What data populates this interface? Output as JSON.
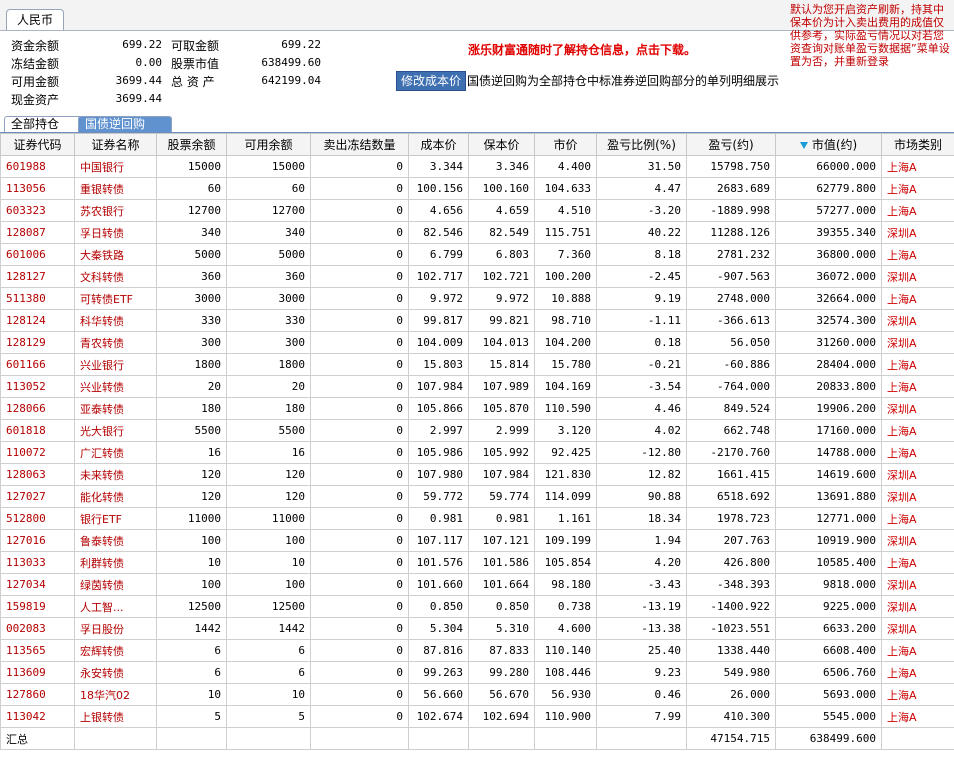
{
  "currency_tab": "人民币",
  "summary": {
    "cash_balance_label": "资金余额",
    "cash_balance": "699.22",
    "frozen_label": "冻结金额",
    "frozen": "0.00",
    "available_label": "可用金额",
    "available": "3699.44",
    "cash_assets_label": "现金资产",
    "cash_assets": "3699.44",
    "withdrawable_label": "可取金额",
    "withdrawable": "699.22",
    "stock_value_label": "股票市值",
    "stock_value": "638499.60",
    "total_assets_label": "总 资 产",
    "total_assets": "642199.04"
  },
  "promo_text": "涨乐财富通随时了解持仓信息，点击下载。",
  "modify_cost_button": "修改成本价",
  "repo_note": "国债逆回购为全部持仓中标准券逆回购部分的单列明细展示",
  "notice_text": "默认为您开启资产刷新，持其中保本价为计入卖出费用的成值仅供参考，实际盈亏情况以对若您资查询对账单盈亏数据据”菜单设置为否，并重新登录",
  "tabs": [
    "全部持仓",
    "国债逆回购"
  ],
  "columns": [
    "证券代码",
    "证券名称",
    "股票余额",
    "可用余额",
    "卖出冻结数量",
    "成本价",
    "保本价",
    "市价",
    "盈亏比例(%)",
    "盈亏(约)",
    "市值(约)",
    "市场类别"
  ],
  "rows": [
    {
      "code": "601988",
      "name": "中国银行",
      "bal": "15000",
      "avail": "15000",
      "frozen": "0",
      "cost": "3.344",
      "breakeven": "3.346",
      "price": "4.400",
      "pct": "31.50",
      "pnl": "15798.750",
      "value": "66000.000",
      "market": "上海A"
    },
    {
      "code": "113056",
      "name": "重银转债",
      "bal": "60",
      "avail": "60",
      "frozen": "0",
      "cost": "100.156",
      "breakeven": "100.160",
      "price": "104.633",
      "pct": "4.47",
      "pnl": "2683.689",
      "value": "62779.800",
      "market": "上海A"
    },
    {
      "code": "603323",
      "name": "苏农银行",
      "bal": "12700",
      "avail": "12700",
      "frozen": "0",
      "cost": "4.656",
      "breakeven": "4.659",
      "price": "4.510",
      "pct": "-3.20",
      "pnl": "-1889.998",
      "value": "57277.000",
      "market": "上海A"
    },
    {
      "code": "128087",
      "name": "孚日转债",
      "bal": "340",
      "avail": "340",
      "frozen": "0",
      "cost": "82.546",
      "breakeven": "82.549",
      "price": "115.751",
      "pct": "40.22",
      "pnl": "11288.126",
      "value": "39355.340",
      "market": "深圳A"
    },
    {
      "code": "601006",
      "name": "大秦铁路",
      "bal": "5000",
      "avail": "5000",
      "frozen": "0",
      "cost": "6.799",
      "breakeven": "6.803",
      "price": "7.360",
      "pct": "8.18",
      "pnl": "2781.232",
      "value": "36800.000",
      "market": "上海A"
    },
    {
      "code": "128127",
      "name": "文科转债",
      "bal": "360",
      "avail": "360",
      "frozen": "0",
      "cost": "102.717",
      "breakeven": "102.721",
      "price": "100.200",
      "pct": "-2.45",
      "pnl": "-907.563",
      "value": "36072.000",
      "market": "深圳A"
    },
    {
      "code": "511380",
      "name": "可转债ETF",
      "bal": "3000",
      "avail": "3000",
      "frozen": "0",
      "cost": "9.972",
      "breakeven": "9.972",
      "price": "10.888",
      "pct": "9.19",
      "pnl": "2748.000",
      "value": "32664.000",
      "market": "上海A"
    },
    {
      "code": "128124",
      "name": "科华转债",
      "bal": "330",
      "avail": "330",
      "frozen": "0",
      "cost": "99.817",
      "breakeven": "99.821",
      "price": "98.710",
      "pct": "-1.11",
      "pnl": "-366.613",
      "value": "32574.300",
      "market": "深圳A"
    },
    {
      "code": "128129",
      "name": "青农转债",
      "bal": "300",
      "avail": "300",
      "frozen": "0",
      "cost": "104.009",
      "breakeven": "104.013",
      "price": "104.200",
      "pct": "0.18",
      "pnl": "56.050",
      "value": "31260.000",
      "market": "深圳A"
    },
    {
      "code": "601166",
      "name": "兴业银行",
      "bal": "1800",
      "avail": "1800",
      "frozen": "0",
      "cost": "15.803",
      "breakeven": "15.814",
      "price": "15.780",
      "pct": "-0.21",
      "pnl": "-60.886",
      "value": "28404.000",
      "market": "上海A"
    },
    {
      "code": "113052",
      "name": "兴业转债",
      "bal": "20",
      "avail": "20",
      "frozen": "0",
      "cost": "107.984",
      "breakeven": "107.989",
      "price": "104.169",
      "pct": "-3.54",
      "pnl": "-764.000",
      "value": "20833.800",
      "market": "上海A"
    },
    {
      "code": "128066",
      "name": "亚泰转债",
      "bal": "180",
      "avail": "180",
      "frozen": "0",
      "cost": "105.866",
      "breakeven": "105.870",
      "price": "110.590",
      "pct": "4.46",
      "pnl": "849.524",
      "value": "19906.200",
      "market": "深圳A"
    },
    {
      "code": "601818",
      "name": "光大银行",
      "bal": "5500",
      "avail": "5500",
      "frozen": "0",
      "cost": "2.997",
      "breakeven": "2.999",
      "price": "3.120",
      "pct": "4.02",
      "pnl": "662.748",
      "value": "17160.000",
      "market": "上海A"
    },
    {
      "code": "110072",
      "name": "广汇转债",
      "bal": "16",
      "avail": "16",
      "frozen": "0",
      "cost": "105.986",
      "breakeven": "105.992",
      "price": "92.425",
      "pct": "-12.80",
      "pnl": "-2170.760",
      "value": "14788.000",
      "market": "上海A"
    },
    {
      "code": "128063",
      "name": "未来转债",
      "bal": "120",
      "avail": "120",
      "frozen": "0",
      "cost": "107.980",
      "breakeven": "107.984",
      "price": "121.830",
      "pct": "12.82",
      "pnl": "1661.415",
      "value": "14619.600",
      "market": "深圳A"
    },
    {
      "code": "127027",
      "name": "能化转债",
      "bal": "120",
      "avail": "120",
      "frozen": "0",
      "cost": "59.772",
      "breakeven": "59.774",
      "price": "114.099",
      "pct": "90.88",
      "pnl": "6518.692",
      "value": "13691.880",
      "market": "深圳A"
    },
    {
      "code": "512800",
      "name": "银行ETF",
      "bal": "11000",
      "avail": "11000",
      "frozen": "0",
      "cost": "0.981",
      "breakeven": "0.981",
      "price": "1.161",
      "pct": "18.34",
      "pnl": "1978.723",
      "value": "12771.000",
      "market": "上海A"
    },
    {
      "code": "127016",
      "name": "鲁泰转债",
      "bal": "100",
      "avail": "100",
      "frozen": "0",
      "cost": "107.117",
      "breakeven": "107.121",
      "price": "109.199",
      "pct": "1.94",
      "pnl": "207.763",
      "value": "10919.900",
      "market": "深圳A"
    },
    {
      "code": "113033",
      "name": "利群转债",
      "bal": "10",
      "avail": "10",
      "frozen": "0",
      "cost": "101.576",
      "breakeven": "101.586",
      "price": "105.854",
      "pct": "4.20",
      "pnl": "426.800",
      "value": "10585.400",
      "market": "上海A"
    },
    {
      "code": "127034",
      "name": "绿茵转债",
      "bal": "100",
      "avail": "100",
      "frozen": "0",
      "cost": "101.660",
      "breakeven": "101.664",
      "price": "98.180",
      "pct": "-3.43",
      "pnl": "-348.393",
      "value": "9818.000",
      "market": "深圳A"
    },
    {
      "code": "159819",
      "name": "人工智...",
      "bal": "12500",
      "avail": "12500",
      "frozen": "0",
      "cost": "0.850",
      "breakeven": "0.850",
      "price": "0.738",
      "pct": "-13.19",
      "pnl": "-1400.922",
      "value": "9225.000",
      "market": "深圳A"
    },
    {
      "code": "002083",
      "name": "孚日股份",
      "bal": "1442",
      "avail": "1442",
      "frozen": "0",
      "cost": "5.304",
      "breakeven": "5.310",
      "price": "4.600",
      "pct": "-13.38",
      "pnl": "-1023.551",
      "value": "6633.200",
      "market": "深圳A"
    },
    {
      "code": "113565",
      "name": "宏辉转债",
      "bal": "6",
      "avail": "6",
      "frozen": "0",
      "cost": "87.816",
      "breakeven": "87.833",
      "price": "110.140",
      "pct": "25.40",
      "pnl": "1338.440",
      "value": "6608.400",
      "market": "上海A"
    },
    {
      "code": "113609",
      "name": "永安转债",
      "bal": "6",
      "avail": "6",
      "frozen": "0",
      "cost": "99.263",
      "breakeven": "99.280",
      "price": "108.446",
      "pct": "9.23",
      "pnl": "549.980",
      "value": "6506.760",
      "market": "上海A"
    },
    {
      "code": "127860",
      "name": "18华汽02",
      "bal": "10",
      "avail": "10",
      "frozen": "0",
      "cost": "56.660",
      "breakeven": "56.670",
      "price": "56.930",
      "pct": "0.46",
      "pnl": "26.000",
      "value": "5693.000",
      "market": "上海A"
    },
    {
      "code": "113042",
      "name": "上银转债",
      "bal": "5",
      "avail": "5",
      "frozen": "0",
      "cost": "102.674",
      "breakeven": "102.694",
      "price": "110.900",
      "pct": "7.99",
      "pnl": "410.300",
      "value": "5545.000",
      "market": "上海A"
    }
  ],
  "total": {
    "label": "汇总",
    "pnl": "47154.715",
    "value": "638499.600"
  }
}
